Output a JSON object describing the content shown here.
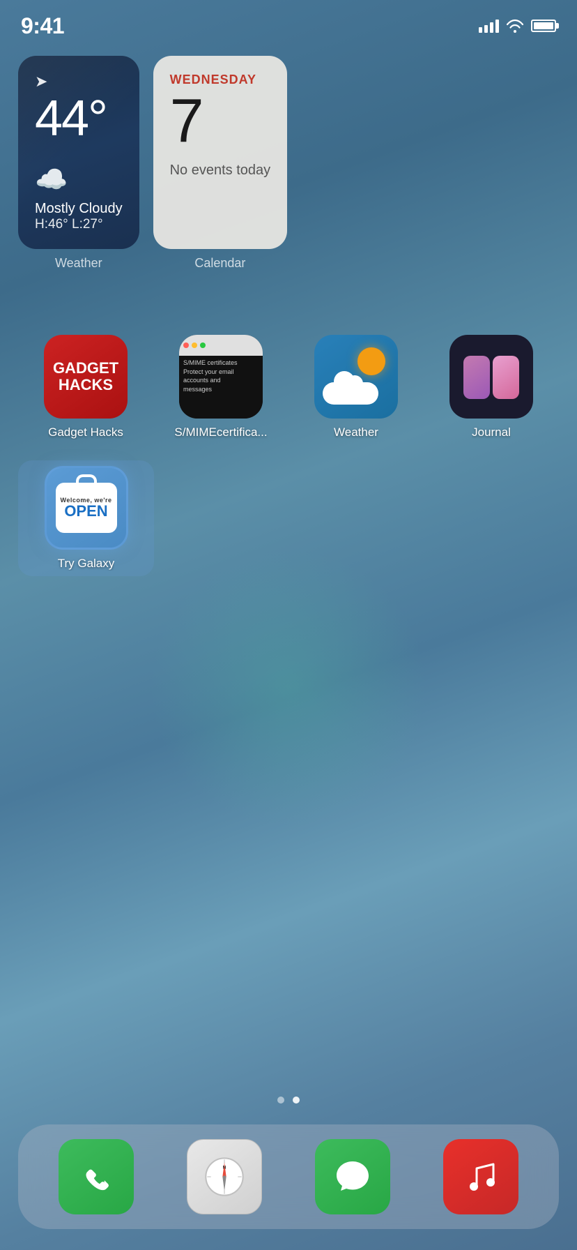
{
  "status": {
    "time": "9:41",
    "signal_bars": 4,
    "wifi": true,
    "battery_full": true
  },
  "weather_widget": {
    "temperature": "44°",
    "condition": "Mostly Cloudy",
    "high": "H:46°",
    "low": "L:27°",
    "label": "Weather"
  },
  "calendar_widget": {
    "day_name": "WEDNESDAY",
    "date": "7",
    "events_text": "No events today",
    "label": "Calendar"
  },
  "apps": [
    {
      "id": "gadget-hacks",
      "label": "Gadget Hacks",
      "icon_type": "gadget-hacks"
    },
    {
      "id": "smime",
      "label": "S/MIMEcertifica...",
      "icon_type": "smime"
    },
    {
      "id": "weather",
      "label": "Weather",
      "icon_type": "weather"
    },
    {
      "id": "journal",
      "label": "Journal",
      "icon_type": "journal"
    },
    {
      "id": "try-galaxy",
      "label": "Try Galaxy",
      "icon_type": "try-galaxy"
    }
  ],
  "page_dots": [
    {
      "active": false
    },
    {
      "active": true
    }
  ],
  "dock": {
    "items": [
      {
        "id": "phone",
        "label": "Phone",
        "icon_type": "phone"
      },
      {
        "id": "safari",
        "label": "Safari",
        "icon_type": "safari"
      },
      {
        "id": "messages",
        "label": "Messages",
        "icon_type": "messages"
      },
      {
        "id": "music",
        "label": "Music",
        "icon_type": "music"
      }
    ]
  }
}
